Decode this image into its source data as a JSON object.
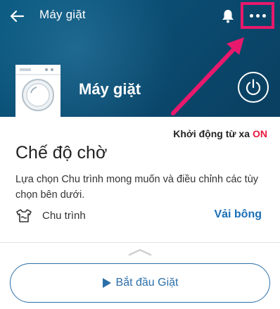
{
  "header": {
    "title": "Máy giặt",
    "device_name": "Máy giặt",
    "icons": {
      "back": "back-arrow-icon",
      "bell": "bell-icon",
      "more": "more-dots-icon",
      "power": "power-icon",
      "device": "washing-machine-icon"
    },
    "highlight_color": "#e8196c"
  },
  "card": {
    "remote_label": "Khởi động từ xa",
    "remote_state": "ON",
    "mode_title": "Chế độ chờ",
    "description": "Lựa chọn Chu trình mong muốn và điều chỉnh các tùy chọn bên dưới.",
    "cycle": {
      "label": "Chu trình",
      "value": "Vải bông",
      "icon": "laundry-cycle-icon"
    }
  },
  "footer": {
    "start_label": "Bắt đầu Giặt",
    "start_icon": "play-icon",
    "accent_color": "#2b6fa8"
  }
}
